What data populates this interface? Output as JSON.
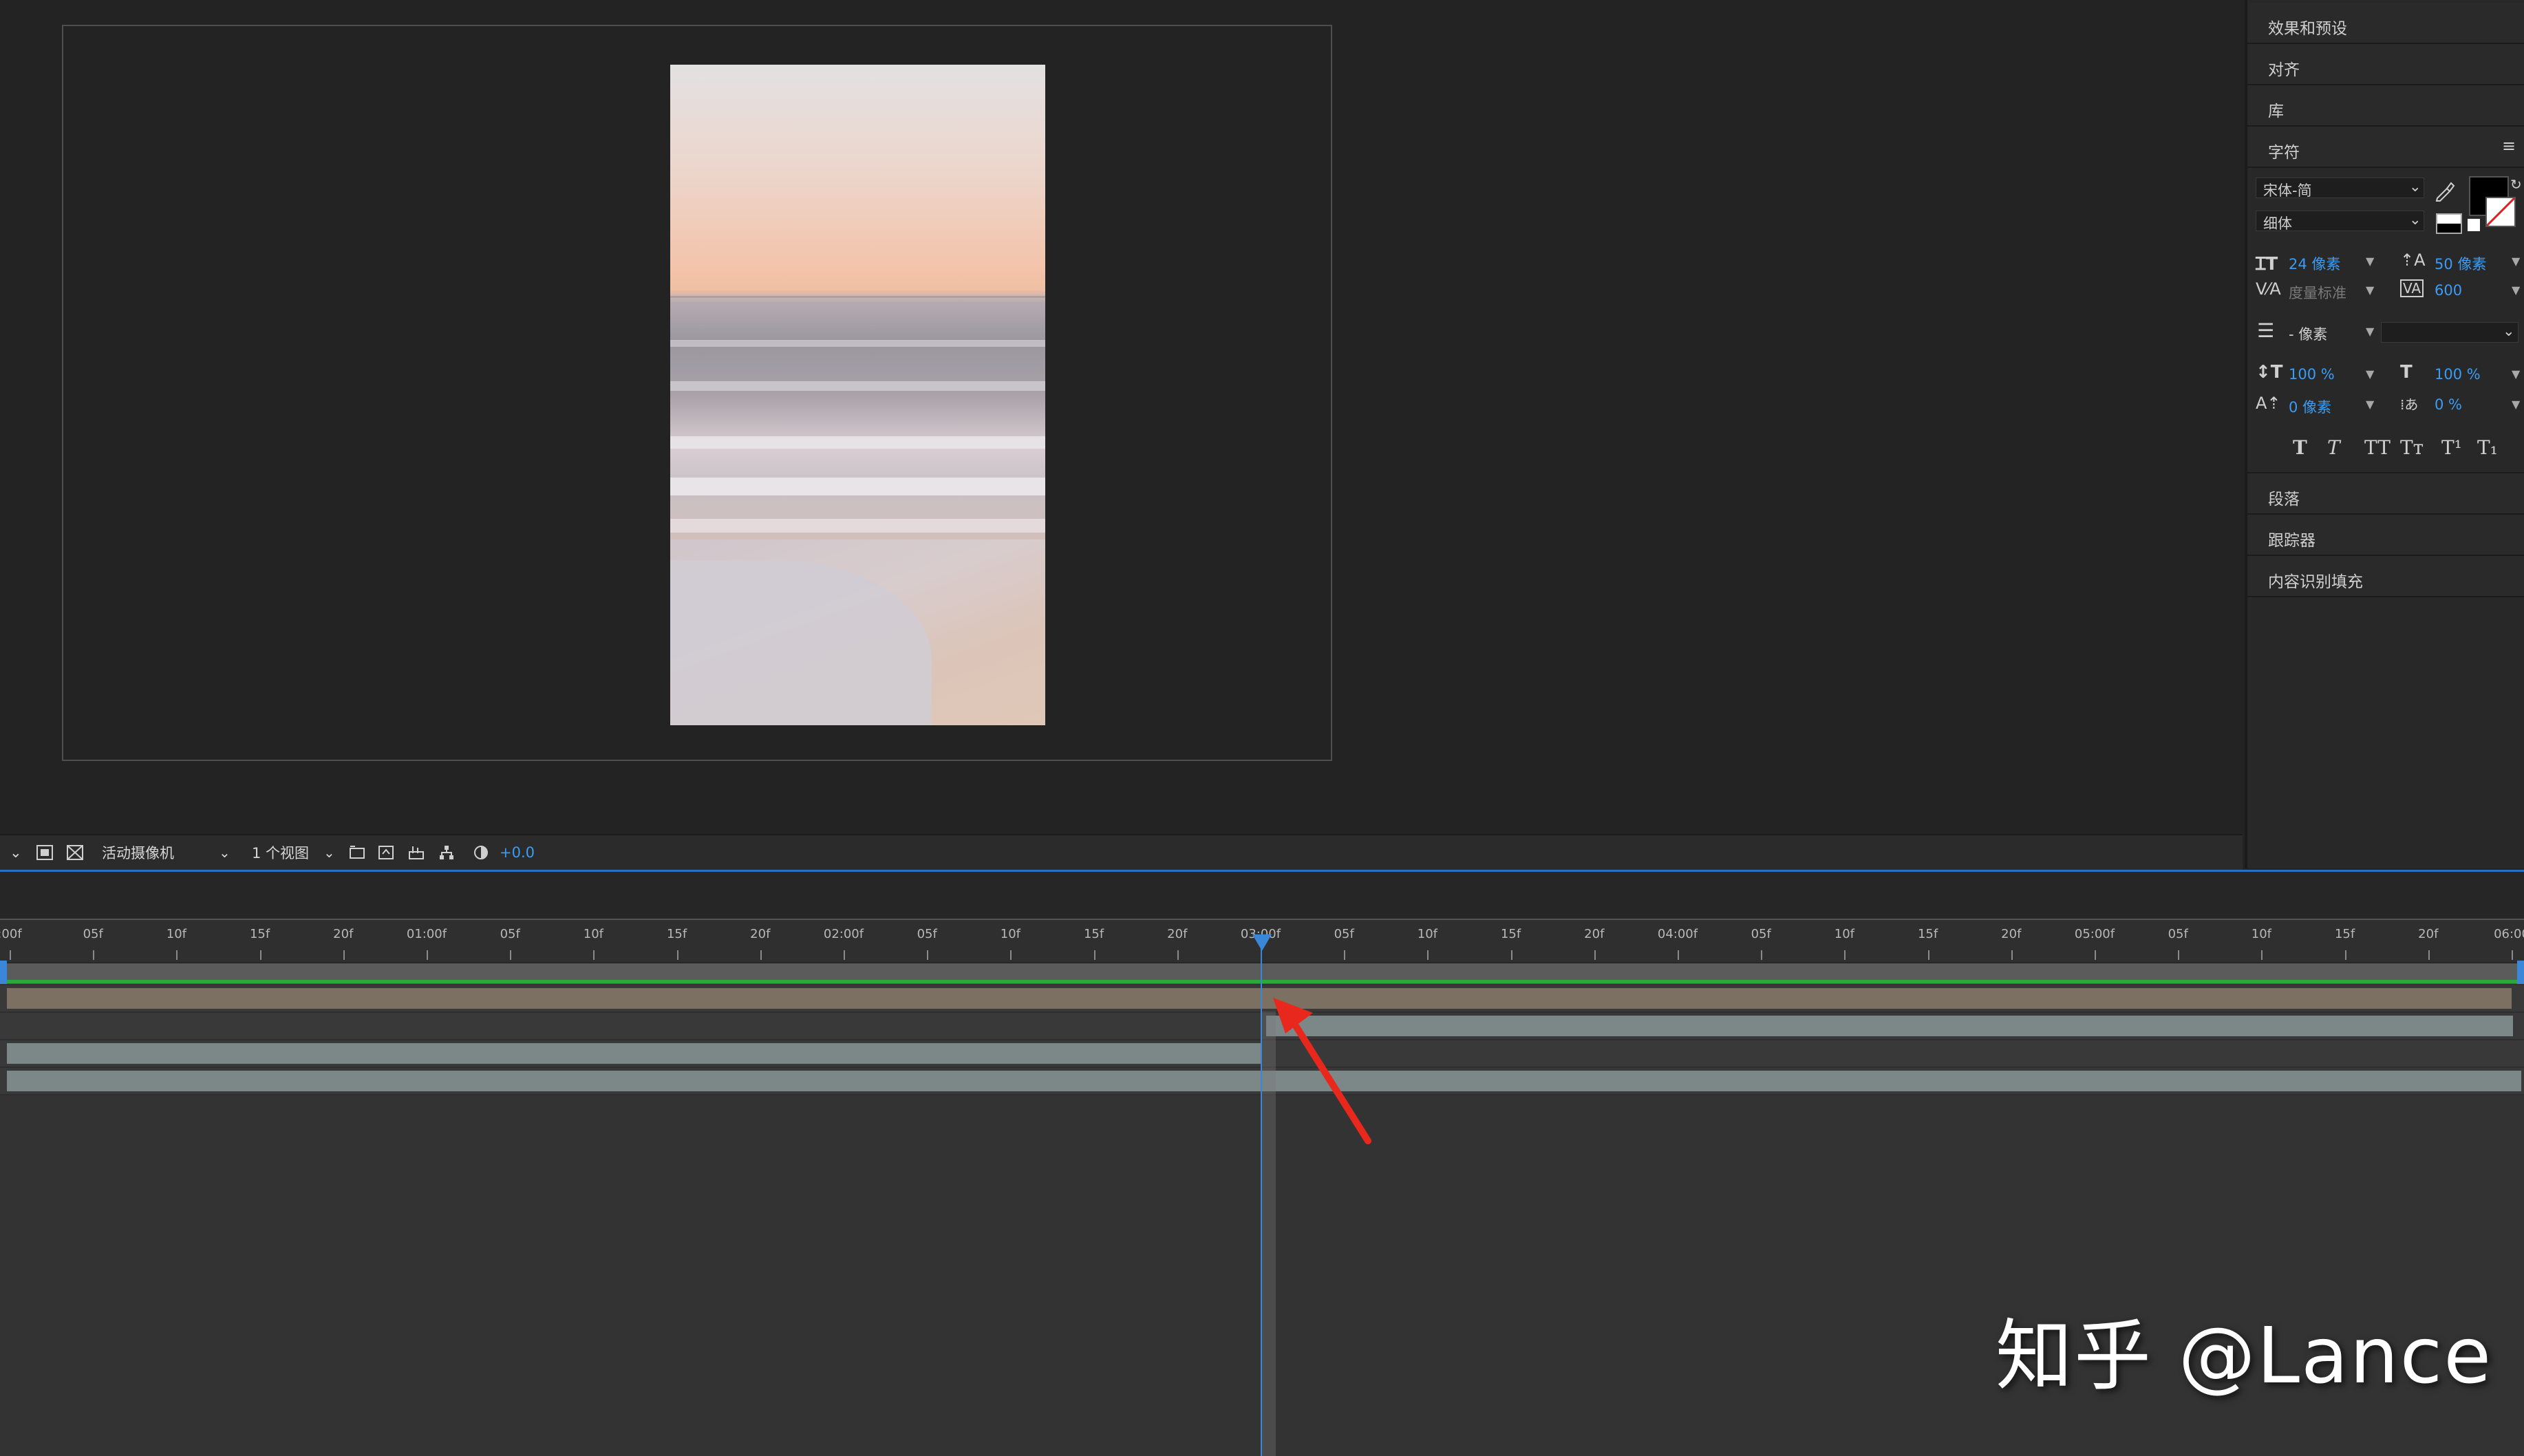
{
  "viewer_toolbar": {
    "camera_select": "活动摄像机",
    "views_select": "1 个视图",
    "exposure": "+0.0"
  },
  "right_panel": {
    "panels": [
      "效果和预设",
      "对齐",
      "库",
      "字符"
    ],
    "character": {
      "font_family": "宋体-简",
      "font_style": "细体",
      "font_size": "24 像素",
      "leading": "50 像素",
      "kerning": "度量标准",
      "tracking": "600",
      "stroke_width": "- 像素",
      "vertical_scale": "100 %",
      "horizontal_scale": "100 %",
      "baseline_shift": "0 像素",
      "tsume": "0 %",
      "style_buttons": [
        "T",
        "T",
        "TT",
        "Tт",
        "T¹",
        "T₁"
      ]
    },
    "lower_panels": [
      "段落",
      "跟踪器",
      "内容识别填充"
    ]
  },
  "timeline": {
    "ruler_labels": [
      ":00f",
      "05f",
      "10f",
      "15f",
      "20f",
      "01:00f",
      "05f",
      "10f",
      "15f",
      "20f",
      "02:00f",
      "05f",
      "10f",
      "15f",
      "20f",
      "03:00f",
      "05f",
      "10f",
      "15f",
      "20f",
      "04:00f",
      "05f",
      "10f",
      "15f",
      "20f",
      "05:00f",
      "05f",
      "10f",
      "15f",
      "20f",
      "06:00"
    ],
    "playhead_time": "03:00f"
  },
  "colors": {
    "accent_blue": "#3a86d9",
    "work_area_green": "#29a93f",
    "footage_bar": "#7b7062",
    "layer_bar": "#7c8887",
    "annotation_arrow": "#e8281c"
  },
  "watermark": "知乎 @Lance"
}
